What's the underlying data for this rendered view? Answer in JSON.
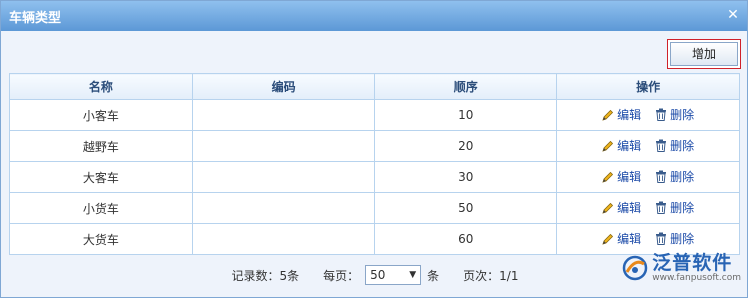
{
  "dialog": {
    "title": "车辆类型"
  },
  "toolbar": {
    "add_label": "增加"
  },
  "table": {
    "headers": [
      "名称",
      "编码",
      "顺序",
      "操作"
    ],
    "rows": [
      {
        "name": "小客车",
        "code": "",
        "order": "10"
      },
      {
        "name": "越野车",
        "code": "",
        "order": "20"
      },
      {
        "name": "大客车",
        "code": "",
        "order": "30"
      },
      {
        "name": "小货车",
        "code": "",
        "order": "50"
      },
      {
        "name": "大货车",
        "code": "",
        "order": "60"
      }
    ],
    "edit_label": "编辑",
    "delete_label": "删除"
  },
  "pager": {
    "records_text": "记录数：5条",
    "per_page_label": "每页：",
    "page_size": "50",
    "unit": "条",
    "page_text": "页次：1/1"
  },
  "logo": {
    "name": "泛普软件",
    "url": "www.fanpusoft.com"
  },
  "colors": {
    "titlebar": "#5c98d6",
    "link": "#1b4aa8",
    "header_text": "#2b4d7a",
    "highlight_border": "#d0212a"
  }
}
